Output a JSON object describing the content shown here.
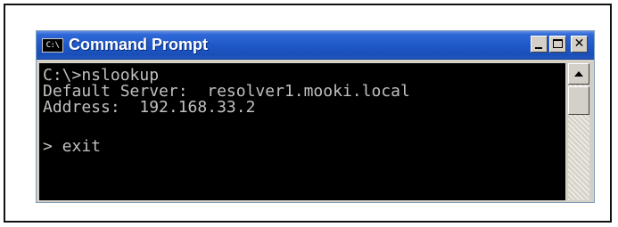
{
  "window": {
    "title": "Command Prompt",
    "icon": "cmd-icon",
    "icon_text": "C:\\"
  },
  "console": {
    "lines": [
      "C:\\>nslookup",
      "Default Server:  resolver1.mooki.local",
      "Address:  192.168.33.2",
      "",
      "> exit"
    ]
  }
}
